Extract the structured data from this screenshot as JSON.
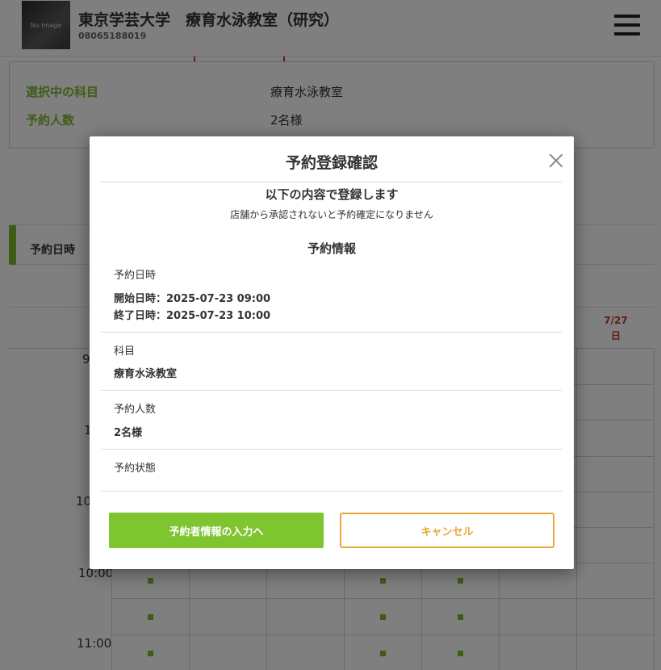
{
  "header": {
    "logo_text": "No Image",
    "shop_name": "東京学芸大学　療育水泳教室（研究）",
    "tel": "08065188019"
  },
  "selection": {
    "subject_label": "選択中の科目",
    "subject_value": "療育水泳教室",
    "people_label": "予約人数",
    "people_value": "2名様"
  },
  "schedule": {
    "date_label": "予約日時",
    "sunday_date": "7/27",
    "sunday_day": "日",
    "time_labels": [
      "9",
      "1",
      "10",
      "10:00",
      "11:00"
    ]
  },
  "modal": {
    "title": "予約登録確認",
    "subtitle": "以下の内容で登録します",
    "note": "店舗から承認されないと予約確定になりません",
    "section_title": "予約情報",
    "datetime_label": "予約日時",
    "start_text": "開始日時：2025-07-23 09:00",
    "end_text": "終了日時：2025-07-23 10:00",
    "subject_label": "科目",
    "subject_value": "療育水泳教室",
    "people_label": "予約人数",
    "people_value": "2名様",
    "status_label": "予約状態",
    "primary_button": "予約者情報の入力へ",
    "cancel_button": "キャンセル"
  },
  "colors": {
    "accent_green": "#7fc52f",
    "label_green": "#7fb92e",
    "cancel_orange": "#e8a837",
    "sunday_red": "#c0392b"
  }
}
